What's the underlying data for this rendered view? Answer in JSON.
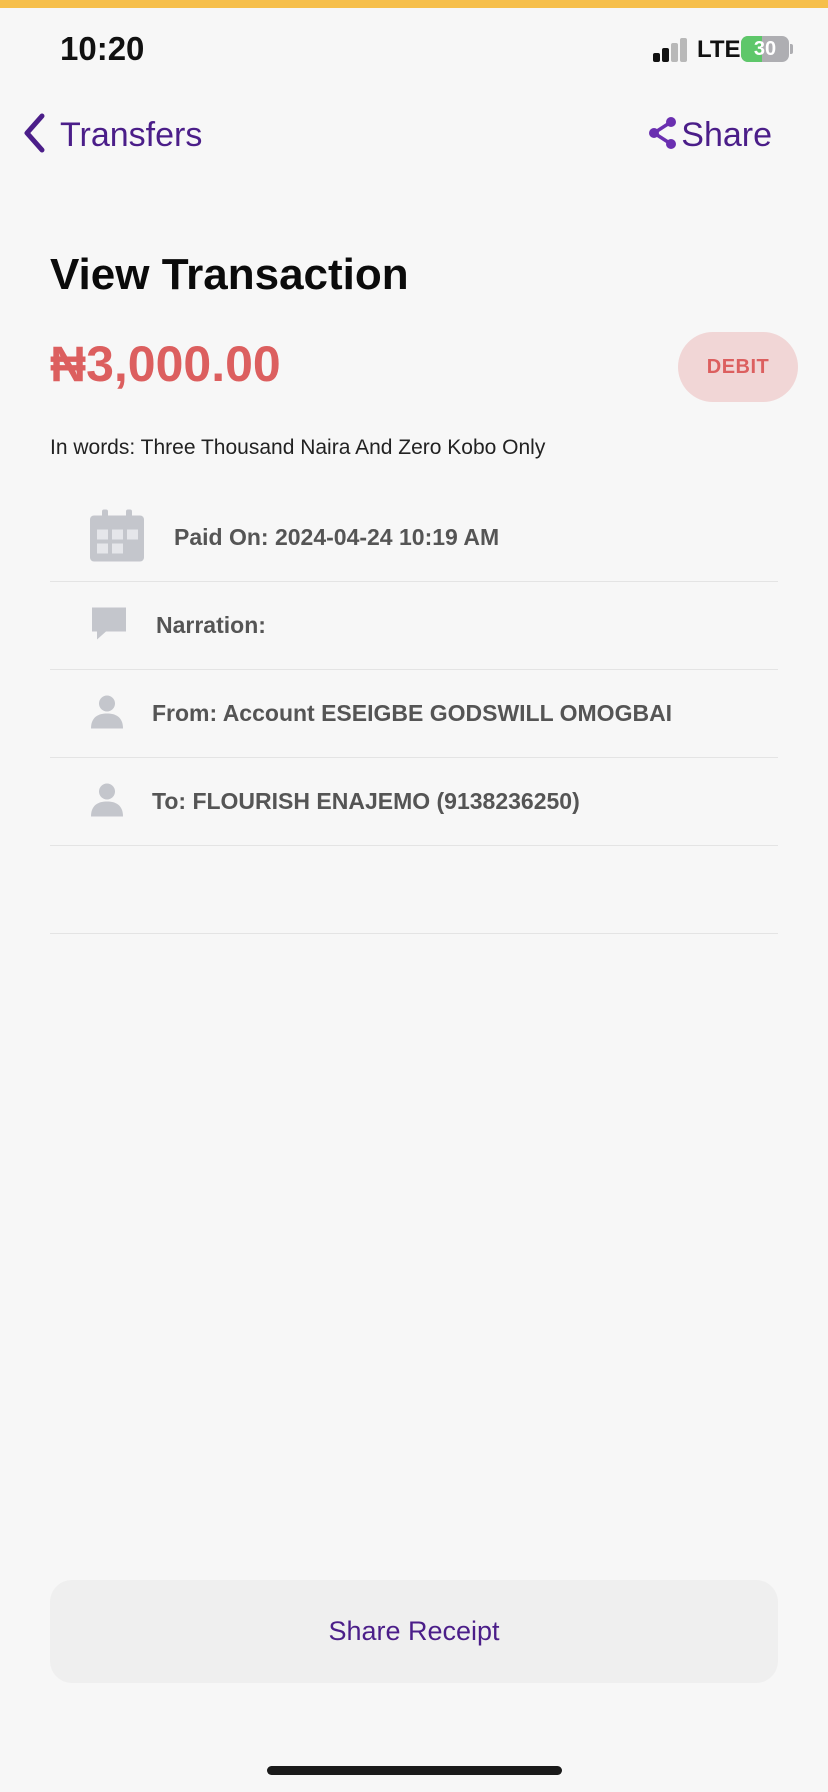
{
  "status_bar": {
    "time": "10:20",
    "network": "LTE",
    "battery": "30"
  },
  "nav": {
    "back_label": "Transfers",
    "share_label": "Share"
  },
  "page": {
    "title": "View Transaction",
    "amount": "₦3,000.00",
    "type_badge": "DEBIT",
    "in_words": "In words: Three Thousand Naira And Zero Kobo Only"
  },
  "details": [
    {
      "icon": "calendar-icon",
      "text": "Paid On: 2024-04-24 10:19 AM"
    },
    {
      "icon": "comment-icon",
      "text": "Narration:"
    },
    {
      "icon": "person-icon",
      "text": "From: Account ESEIGBE GODSWILL OMOGBAI"
    },
    {
      "icon": "person-icon",
      "text": "To: FLOURISH ENAJEMO  (9138236250)"
    }
  ],
  "actions": {
    "share_receipt": "Share Receipt"
  },
  "colors": {
    "accent": "#4b1e89",
    "debit": "#dc5f5f",
    "debit_bg": "#f1d6d6",
    "top_bar": "#f6bf4b"
  }
}
